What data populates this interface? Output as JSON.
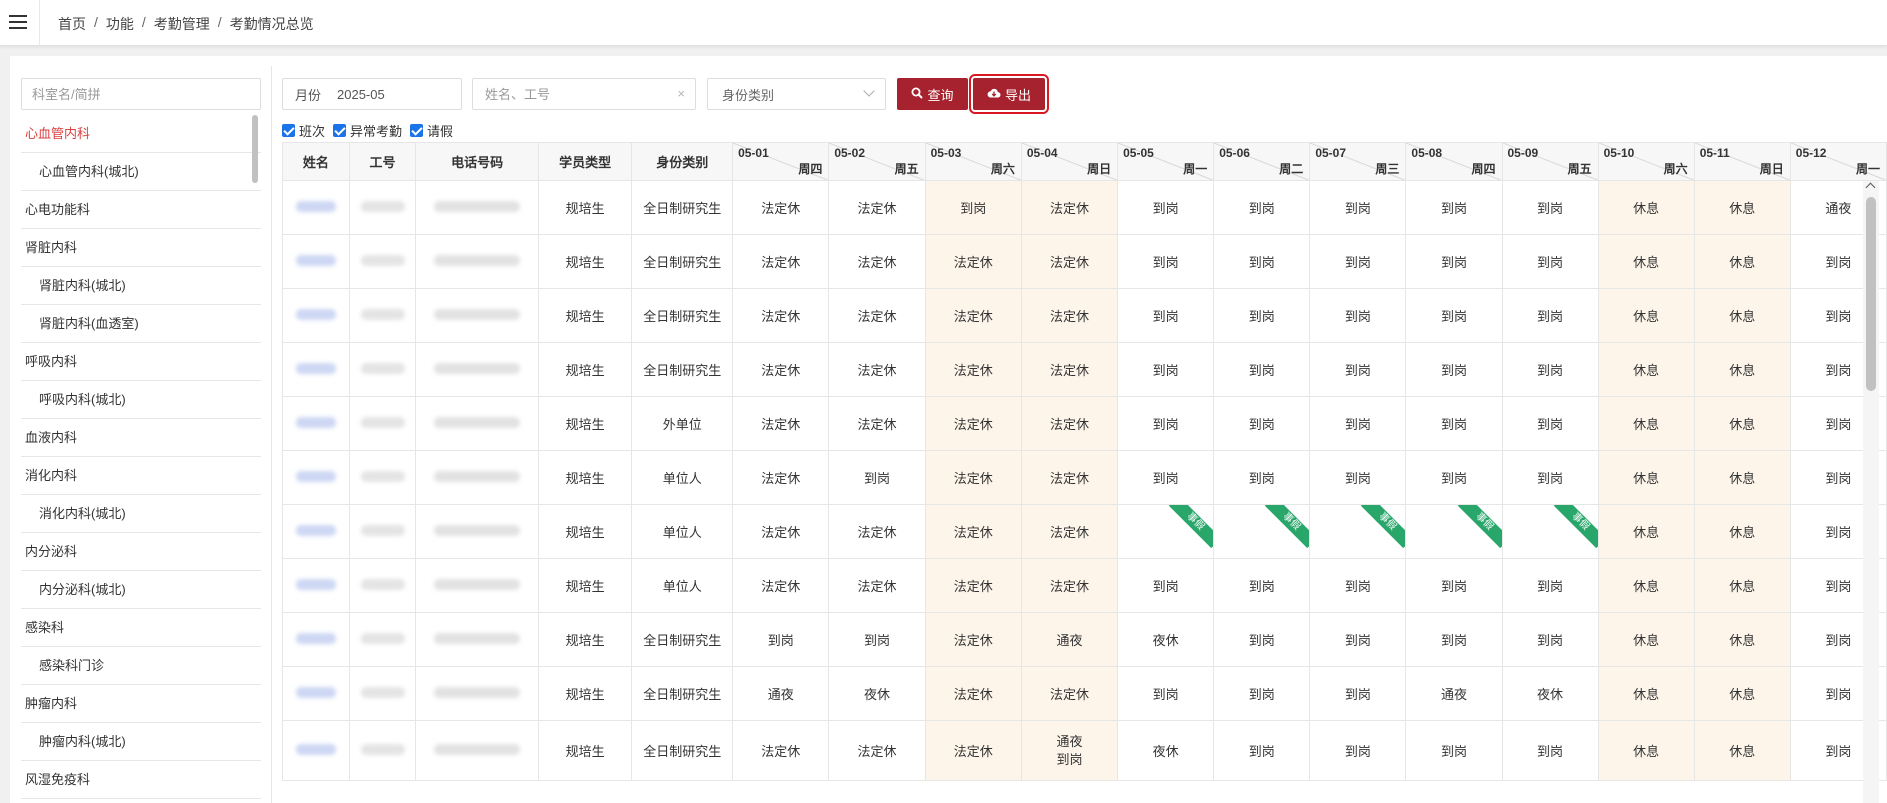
{
  "breadcrumb": [
    "首页",
    "功能",
    "考勤管理",
    "考勤情况总览"
  ],
  "sidebar": {
    "search_placeholder": "科室名/简拼",
    "items": [
      {
        "label": "心血管内科",
        "sub": false,
        "active": true
      },
      {
        "label": "心血管内科(城北)",
        "sub": true
      },
      {
        "label": "心电功能科",
        "sub": false
      },
      {
        "label": "肾脏内科",
        "sub": false
      },
      {
        "label": "肾脏内科(城北)",
        "sub": true
      },
      {
        "label": "肾脏内科(血透室)",
        "sub": true
      },
      {
        "label": "呼吸内科",
        "sub": false
      },
      {
        "label": "呼吸内科(城北)",
        "sub": true
      },
      {
        "label": "血液内科",
        "sub": false
      },
      {
        "label": "消化内科",
        "sub": false
      },
      {
        "label": "消化内科(城北)",
        "sub": true
      },
      {
        "label": "内分泌科",
        "sub": false
      },
      {
        "label": "内分泌科(城北)",
        "sub": true
      },
      {
        "label": "感染科",
        "sub": false
      },
      {
        "label": "感染科门诊",
        "sub": true
      },
      {
        "label": "肿瘤内科",
        "sub": false
      },
      {
        "label": "肿瘤内科(城北)",
        "sub": true
      },
      {
        "label": "风湿免疫科",
        "sub": false
      }
    ]
  },
  "filters": {
    "month_label": "月份",
    "month_value": "2025-05",
    "name_placeholder": "姓名、工号",
    "clear_icon": "×",
    "type_placeholder": "身份类别"
  },
  "buttons": {
    "query": "查询",
    "export": "导出"
  },
  "checkboxes": [
    "班次",
    "异常考勤",
    "请假"
  ],
  "table": {
    "fixed_headers": [
      "姓名",
      "工号",
      "电话号码",
      "学员类型",
      "身份类别"
    ],
    "days": [
      {
        "date": "05-01",
        "week": "周四",
        "weekend": false
      },
      {
        "date": "05-02",
        "week": "周五",
        "weekend": false
      },
      {
        "date": "05-03",
        "week": "周六",
        "weekend": true
      },
      {
        "date": "05-04",
        "week": "周日",
        "weekend": true
      },
      {
        "date": "05-05",
        "week": "周一",
        "weekend": false
      },
      {
        "date": "05-06",
        "week": "周二",
        "weekend": false
      },
      {
        "date": "05-07",
        "week": "周三",
        "weekend": false
      },
      {
        "date": "05-08",
        "week": "周四",
        "weekend": false
      },
      {
        "date": "05-09",
        "week": "周五",
        "weekend": false
      },
      {
        "date": "05-10",
        "week": "周六",
        "weekend": true
      },
      {
        "date": "05-11",
        "week": "周日",
        "weekend": true
      },
      {
        "date": "05-12",
        "week": "周一",
        "weekend": false
      }
    ],
    "leave_label": "事假",
    "rows": [
      {
        "type": "规培生",
        "category": "全日制研究生",
        "cells": [
          "法定休",
          "法定休",
          "到岗",
          "法定休",
          "到岗",
          "到岗",
          "到岗",
          "到岗",
          "到岗",
          "休息",
          "休息",
          "通夜"
        ]
      },
      {
        "type": "规培生",
        "category": "全日制研究生",
        "cells": [
          "法定休",
          "法定休",
          "法定休",
          "法定休",
          "到岗",
          "到岗",
          "到岗",
          "到岗",
          "到岗",
          "休息",
          "休息",
          "到岗"
        ]
      },
      {
        "type": "规培生",
        "category": "全日制研究生",
        "cells": [
          "法定休",
          "法定休",
          "法定休",
          "法定休",
          "到岗",
          "到岗",
          "到岗",
          "到岗",
          "到岗",
          "休息",
          "休息",
          "到岗"
        ]
      },
      {
        "type": "规培生",
        "category": "全日制研究生",
        "cells": [
          "法定休",
          "法定休",
          "法定休",
          "法定休",
          "到岗",
          "到岗",
          "到岗",
          "到岗",
          "到岗",
          "休息",
          "休息",
          "到岗"
        ]
      },
      {
        "type": "规培生",
        "category": "外单位",
        "cells": [
          "法定休",
          "法定休",
          "法定休",
          "法定休",
          "到岗",
          "到岗",
          "到岗",
          "到岗",
          "到岗",
          "休息",
          "休息",
          "到岗"
        ]
      },
      {
        "type": "规培生",
        "category": "单位人",
        "cells": [
          "法定休",
          "到岗",
          "法定休",
          "法定休",
          "到岗",
          "到岗",
          "到岗",
          "到岗",
          "到岗",
          "休息",
          "休息",
          "到岗"
        ]
      },
      {
        "type": "规培生",
        "category": "单位人",
        "cells": [
          "法定休",
          "法定休",
          "法定休",
          "法定休",
          "事假",
          "事假",
          "事假",
          "事假",
          "事假",
          "休息",
          "休息",
          "到岗"
        ]
      },
      {
        "type": "规培生",
        "category": "单位人",
        "cells": [
          "法定休",
          "法定休",
          "法定休",
          "法定休",
          "到岗",
          "到岗",
          "到岗",
          "到岗",
          "到岗",
          "休息",
          "休息",
          "到岗"
        ]
      },
      {
        "type": "规培生",
        "category": "全日制研究生",
        "cells": [
          "到岗",
          "到岗",
          "法定休",
          "通夜",
          "夜休",
          "到岗",
          "到岗",
          "到岗",
          "到岗",
          "休息",
          "休息",
          "到岗"
        ]
      },
      {
        "type": "规培生",
        "category": "全日制研究生",
        "cells": [
          "通夜",
          "夜休",
          "法定休",
          "法定休",
          "到岗",
          "到岗",
          "到岗",
          "通夜",
          "夜休",
          "休息",
          "休息",
          "到岗"
        ]
      },
      {
        "type": "规培生",
        "category": "全日制研究生",
        "cells": [
          "法定休",
          "法定休",
          "法定休",
          "通夜\n到岗",
          "夜休",
          "到岗",
          "到岗",
          "到岗",
          "到岗",
          "休息",
          "休息",
          "到岗"
        ]
      }
    ]
  },
  "colors": {
    "primary": "#a5222e",
    "active_dept": "#d9413f",
    "weekend_bg": "#fdf5ea",
    "leave_ribbon": "#29a66a",
    "checkbox": "#1a73e8"
  }
}
